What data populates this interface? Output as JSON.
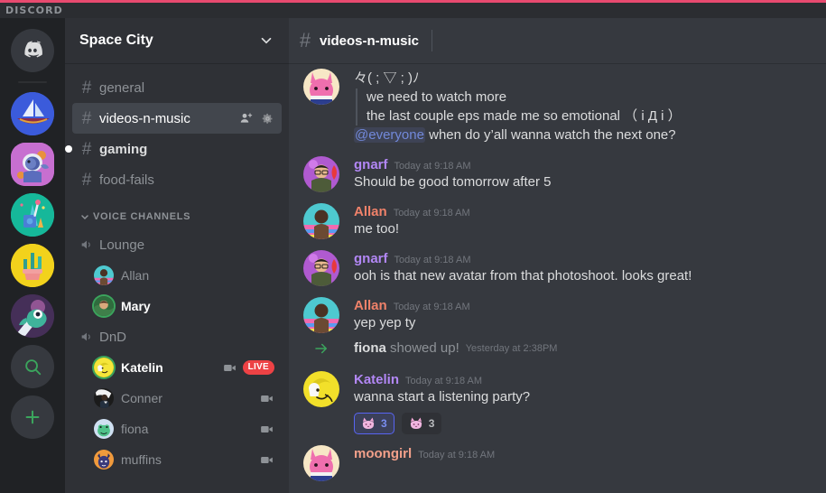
{
  "window": {
    "wordmark": "DISCORD",
    "accent_line": "#e84a6f"
  },
  "theme": {
    "rail_bg": "#202225",
    "sidebar_bg": "#2f3136",
    "chat_bg": "#36393f",
    "selected_bg": "#42464d",
    "text_normal": "#dcddde",
    "text_muted": "#8e9297",
    "green": "#3ba55d",
    "live_red": "#ed4245",
    "mention_blurple": "#7289da"
  },
  "rail": {
    "items": [
      {
        "name": "home-button",
        "icon": "discord-logo-icon",
        "style": "home",
        "indicator": "none"
      },
      {
        "name": "guild-sailboat",
        "icon": "sailboat-icon",
        "style": "boat",
        "indicator": "none"
      },
      {
        "name": "guild-space-city",
        "icon": "astronaut-whale-icon",
        "style": "whale",
        "indicator": "active"
      },
      {
        "name": "guild-easel",
        "icon": "easel-icon",
        "style": "easel",
        "indicator": "none"
      },
      {
        "name": "guild-cactus",
        "icon": "cactus-icon",
        "style": "cactus",
        "indicator": "none"
      },
      {
        "name": "guild-monster",
        "icon": "monster-icon",
        "style": "monster",
        "indicator": "none"
      },
      {
        "name": "explore-servers-button",
        "icon": "search-icon",
        "style": "action",
        "indicator": "none"
      },
      {
        "name": "add-server-button",
        "icon": "plus-icon",
        "style": "action",
        "indicator": "none"
      }
    ]
  },
  "sidebar": {
    "server_name": "Space City",
    "server_dropdown_icon": "chevron-down-icon",
    "text_channels": [
      {
        "name": "general",
        "selected": false,
        "unread": false
      },
      {
        "name": "videos-n-music",
        "selected": true,
        "unread": false,
        "actions": [
          "add-member-icon",
          "gear-icon"
        ]
      },
      {
        "name": "gaming",
        "selected": false,
        "unread": true
      },
      {
        "name": "food-fails",
        "selected": false,
        "unread": false
      }
    ],
    "voice_category": {
      "label": "VOICE CHANNELS",
      "collapse_icon": "chevron-down-icon"
    },
    "voice_channels": [
      {
        "name": "Lounge",
        "members": [
          {
            "name": "Allan",
            "speaking": false,
            "camera": false,
            "live": false,
            "avatar": "allan-avatar"
          },
          {
            "name": "Mary",
            "speaking": true,
            "camera": false,
            "live": false,
            "avatar": "mary-avatar"
          }
        ]
      },
      {
        "name": "DnD",
        "members": [
          {
            "name": "Katelin",
            "speaking": true,
            "camera": true,
            "live": true,
            "live_label": "LIVE",
            "avatar": "katelin-avatar"
          },
          {
            "name": "Conner",
            "speaking": false,
            "camera": true,
            "live": false,
            "avatar": "conner-avatar"
          },
          {
            "name": "fiona",
            "speaking": false,
            "camera": true,
            "live": false,
            "avatar": "fiona-avatar"
          },
          {
            "name": "muffins",
            "speaking": false,
            "camera": true,
            "live": false,
            "avatar": "muffins-avatar"
          }
        ]
      }
    ]
  },
  "channel_header": {
    "hash": "#",
    "title": "videos-n-music"
  },
  "messages": [
    {
      "type": "message",
      "author": "moongirl",
      "author_color": "#f2a08a",
      "avatar": "moongirl-avatar",
      "show_header": false,
      "lines": [
        {
          "style": "plain",
          "text": "々( ; ▽ ; )ﾉ"
        },
        {
          "style": "quote",
          "text": "we need to watch more"
        },
        {
          "style": "quote",
          "text": "the last couple eps made me so emotional （ i Д i ）"
        }
      ],
      "mention_line": {
        "mention": "@everyone",
        "text": " when do y’all wanna watch the next one?"
      }
    },
    {
      "type": "message",
      "author": "gnarf",
      "author_color": "#b287f5",
      "timestamp": "Today at 9:18 AM",
      "avatar": "gnarf-avatar",
      "show_header": true,
      "lines": [
        {
          "style": "plain",
          "text": "Should be good tomorrow after 5"
        }
      ]
    },
    {
      "type": "message",
      "author": "Allan",
      "author_color": "#f0826a",
      "timestamp": "Today at 9:18 AM",
      "avatar": "allan-avatar",
      "show_header": true,
      "lines": [
        {
          "style": "plain",
          "text": "me too!"
        }
      ]
    },
    {
      "type": "message",
      "author": "gnarf",
      "author_color": "#b287f5",
      "timestamp": "Today at 9:18 AM",
      "avatar": "gnarf-avatar",
      "show_header": true,
      "lines": [
        {
          "style": "plain",
          "text": "ooh is that new avatar from that photoshoot. looks great!"
        }
      ]
    },
    {
      "type": "message",
      "author": "Allan",
      "author_color": "#f0826a",
      "timestamp": "Today at 9:18 AM",
      "avatar": "allan-avatar",
      "show_header": true,
      "lines": [
        {
          "style": "plain",
          "text": "yep yep ty"
        }
      ]
    },
    {
      "type": "system",
      "icon": "arrow-right-icon",
      "actor": "fiona",
      "action": " showed up!",
      "timestamp": "Yesterday at 2:38PM"
    },
    {
      "type": "message",
      "author": "Katelin",
      "author_color": "#b287f5",
      "timestamp": "Today at 9:18 AM",
      "avatar": "katelin-avatar",
      "show_header": true,
      "lines": [
        {
          "style": "plain",
          "text": "wanna start a listening party?"
        }
      ],
      "reactions": [
        {
          "emoji": "pink-cat-emoji",
          "count": "3",
          "reacted_by_me": true
        },
        {
          "emoji": "pink-cat-emoji",
          "count": "3",
          "reacted_by_me": false
        }
      ]
    },
    {
      "type": "message",
      "author": "moongirl",
      "author_color": "#f2a08a",
      "timestamp": "Today at 9:18 AM",
      "avatar": "moongirl-avatar",
      "show_header": true,
      "lines": []
    }
  ]
}
